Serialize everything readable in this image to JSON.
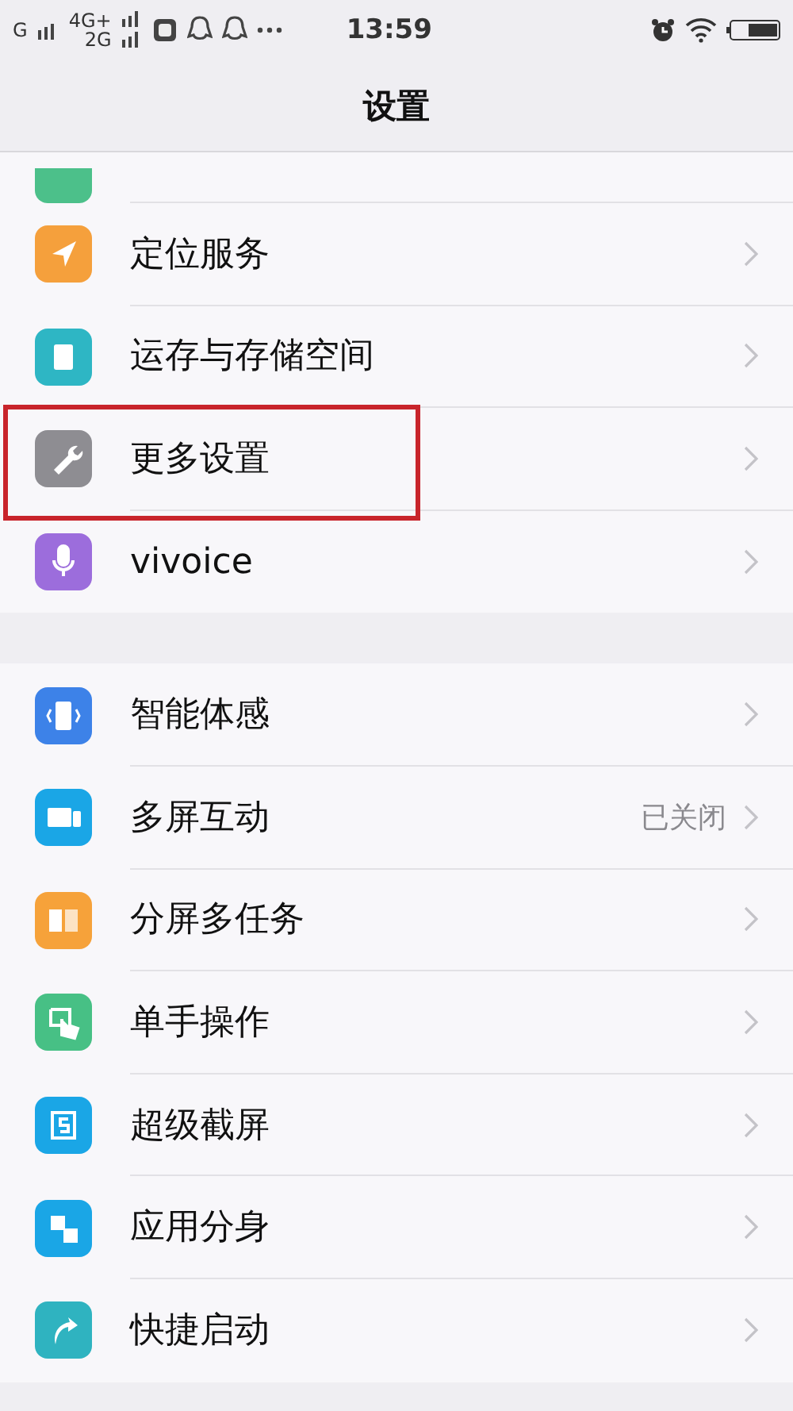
{
  "status_bar": {
    "network_1": "G",
    "network_2": "4G+",
    "network_3": "2G",
    "time": "13:59"
  },
  "header": {
    "title": "设置"
  },
  "partial_row": {
    "color": "#4cc08a"
  },
  "sections": [
    {
      "items": [
        {
          "label": "定位服务",
          "color": "#f5a03c",
          "highlighted": false
        },
        {
          "label": "运存与存储空间",
          "color": "#2eb6c4",
          "highlighted": false
        },
        {
          "label": "更多设置",
          "color": "#8e8d92",
          "highlighted": true
        },
        {
          "label": "vivoice",
          "color": "#9c6ddc",
          "highlighted": false
        }
      ]
    },
    {
      "items": [
        {
          "label": "智能体感",
          "color": "#3d82e8",
          "highlighted": false
        },
        {
          "label": "多屏互动",
          "color": "#1aa6e6",
          "highlighted": false,
          "value": "已关闭"
        },
        {
          "label": "分屏多任务",
          "color": "#f6a23a",
          "highlighted": false
        },
        {
          "label": "单手操作",
          "color": "#47c085",
          "highlighted": false
        },
        {
          "label": "超级截屏",
          "color": "#1aa6e6",
          "highlighted": false
        },
        {
          "label": "应用分身",
          "color": "#1aa6e6",
          "highlighted": false
        },
        {
          "label": "快捷启动",
          "color": "#2fb3c0",
          "highlighted": false
        }
      ]
    }
  ]
}
